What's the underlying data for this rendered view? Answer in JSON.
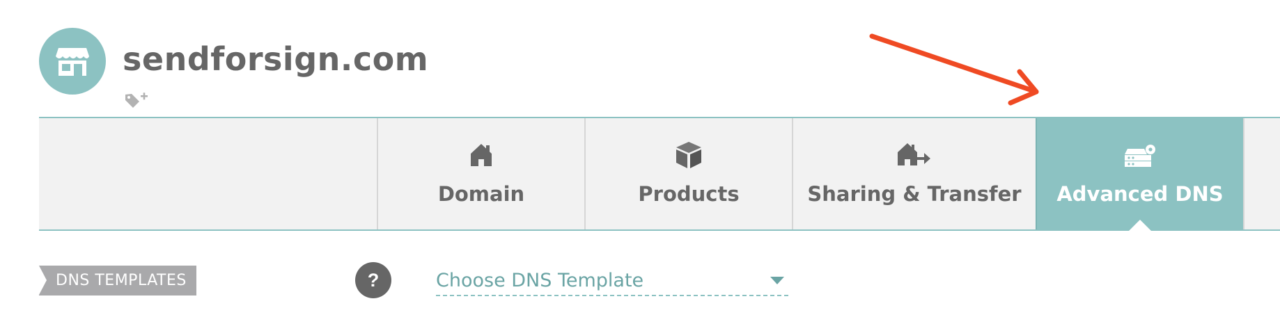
{
  "header": {
    "domain": "sendforsign.com",
    "avatar_icon": "storefront-icon",
    "tag_icon": "tag-add-icon"
  },
  "tabs": [
    {
      "label": "Domain",
      "icon": "house-icon",
      "active": false
    },
    {
      "label": "Products",
      "icon": "box-icon",
      "active": false
    },
    {
      "label": "Sharing & Transfer",
      "icon": "house-transfer-icon",
      "active": false
    },
    {
      "label": "Advanced DNS",
      "icon": "server-gear-icon",
      "active": true
    }
  ],
  "annotation": {
    "icon": "red-arrow-icon",
    "color": "#ef4a23"
  },
  "dns_templates": {
    "badge_label": "DNS TEMPLATES",
    "help_label": "?",
    "select_placeholder": "Choose DNS Template"
  },
  "colors": {
    "accent": "#8cc2c2",
    "tab_bg": "#f2f2f2",
    "badge_bg": "#a9a9ab",
    "arrow": "#ef4a23"
  }
}
